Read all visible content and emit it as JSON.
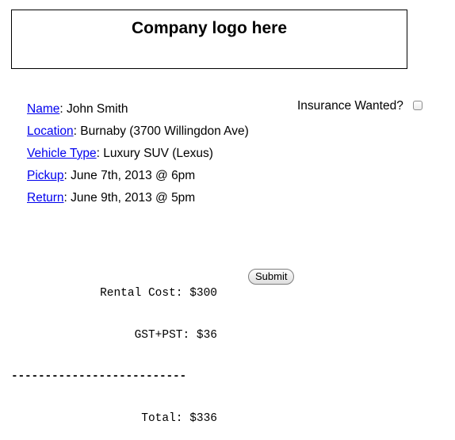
{
  "header": {
    "logo_placeholder": "Company logo here"
  },
  "details": {
    "name": {
      "label": "Name",
      "value": "John Smith"
    },
    "location": {
      "label": "Location",
      "value": "Burnaby (3700 Willingdon Ave)"
    },
    "vehicle_type": {
      "label": "Vehicle Type",
      "value": "Luxury SUV (Lexus)"
    },
    "pickup": {
      "label": "Pickup",
      "value": "June 7th, 2013 @ 6pm"
    },
    "return": {
      "label": "Return",
      "value": "June 9th, 2013 @ 5pm"
    },
    "separator": ": "
  },
  "insurance": {
    "label": "Insurance Wanted?",
    "checked": false
  },
  "costs": {
    "rental_cost_label": "Rental Cost:",
    "rental_cost_value": "$300",
    "tax_label": "GST+PST:",
    "tax_value": "$36",
    "divider": "--------------------------",
    "total_label": "Total:",
    "total_value": "$336"
  },
  "actions": {
    "submit_label": "Submit"
  }
}
